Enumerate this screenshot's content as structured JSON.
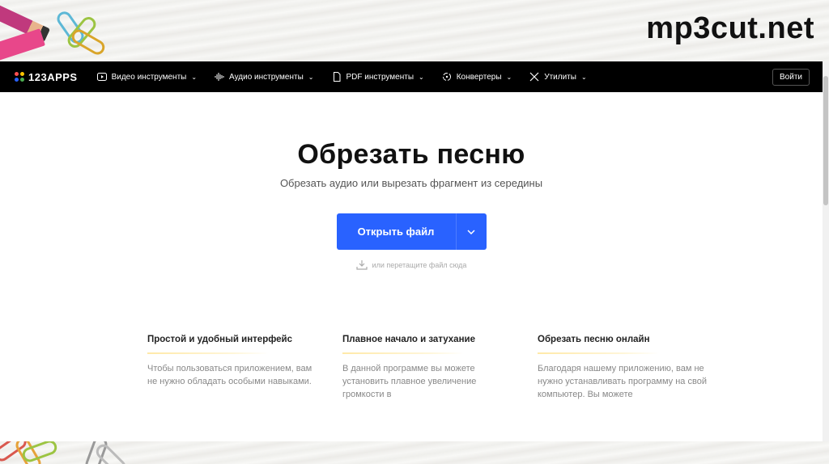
{
  "slide": {
    "title": "mp3cut.net"
  },
  "navbar": {
    "logo_text": "123APPS",
    "logo_colors": [
      "#ff4f4f",
      "#ffc400",
      "#2962ff",
      "#4caf50"
    ],
    "items": [
      {
        "label": "Видео инструменты",
        "icon": "play-icon"
      },
      {
        "label": "Аудио инструменты",
        "icon": "waveform-icon"
      },
      {
        "label": "PDF инструменты",
        "icon": "document-icon"
      },
      {
        "label": "Конвертеры",
        "icon": "convert-icon"
      },
      {
        "label": "Утилиты",
        "icon": "tools-icon"
      }
    ],
    "login_label": "Войти"
  },
  "hero": {
    "title": "Обрезать песню",
    "subtitle": "Обрезать аудио или вырезать фрагмент из середины",
    "open_button_label": "Открыть файл",
    "drop_hint": "или перетащите файл сюда"
  },
  "features": [
    {
      "title": "Простой и удобный интерфейс",
      "text": "Чтобы пользоваться приложением, вам не нужно обладать особыми навыками."
    },
    {
      "title": "Плавное начало и затухание",
      "text": "В данной программе вы можете установить плавное увеличение громкости в"
    },
    {
      "title": "Обрезать песню онлайн",
      "text": "Благодаря нашему приложению, вам не нужно устанавливать программу на свой компьютер. Вы можете"
    }
  ],
  "colors": {
    "accent": "#2962ff",
    "navbar_bg": "#000000"
  }
}
